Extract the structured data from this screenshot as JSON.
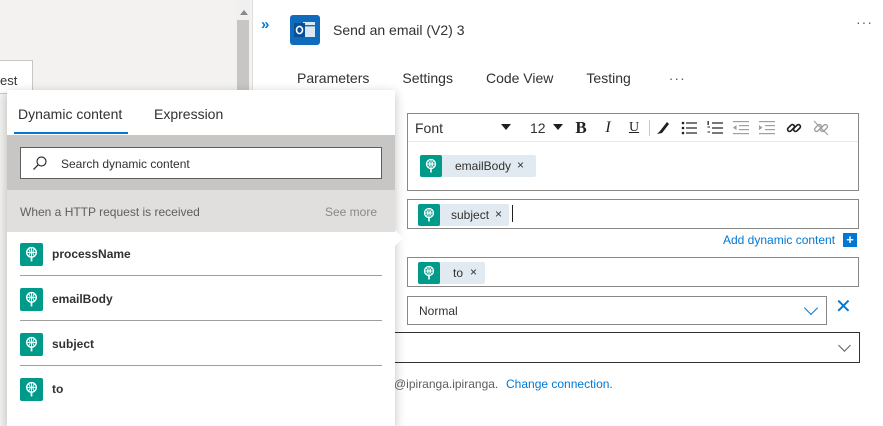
{
  "background_card": {
    "label": "est"
  },
  "action": {
    "title": "Send an email (V2) 3",
    "more": "···",
    "collapse": "»",
    "icon": "outlook-icon"
  },
  "tabs": [
    {
      "label": "Parameters"
    },
    {
      "label": "Settings"
    },
    {
      "label": "Code View"
    },
    {
      "label": "Testing"
    }
  ],
  "tabs_more": "···",
  "editor": {
    "font": "Font",
    "size": "12",
    "bold": "B",
    "italic": "I",
    "underline": "U",
    "body_token": {
      "label": "emailBody",
      "close": "×"
    }
  },
  "subject_field": {
    "token": {
      "label": "subject",
      "close": "×"
    }
  },
  "add_dynamic": {
    "label": "Add dynamic content",
    "plus": "+"
  },
  "to_field": {
    "token": {
      "label": "to",
      "close": "×"
    }
  },
  "importance": {
    "value": "Normal",
    "clear": "✕"
  },
  "connection": {
    "text": "@ipiranga.ipiranga.",
    "link": "Change connection."
  },
  "flyout": {
    "tabs": {
      "dynamic": "Dynamic content",
      "expression": "Expression"
    },
    "search_placeholder": "Search dynamic content",
    "section": {
      "title": "When a HTTP request is received",
      "see_more": "See more"
    },
    "items": [
      {
        "label": "processName"
      },
      {
        "label": "emailBody"
      },
      {
        "label": "subject"
      },
      {
        "label": "to"
      }
    ]
  },
  "colors": {
    "accent": "#0078d4",
    "token_icon": "#009a8b",
    "outlook": "#0f6cbd"
  }
}
